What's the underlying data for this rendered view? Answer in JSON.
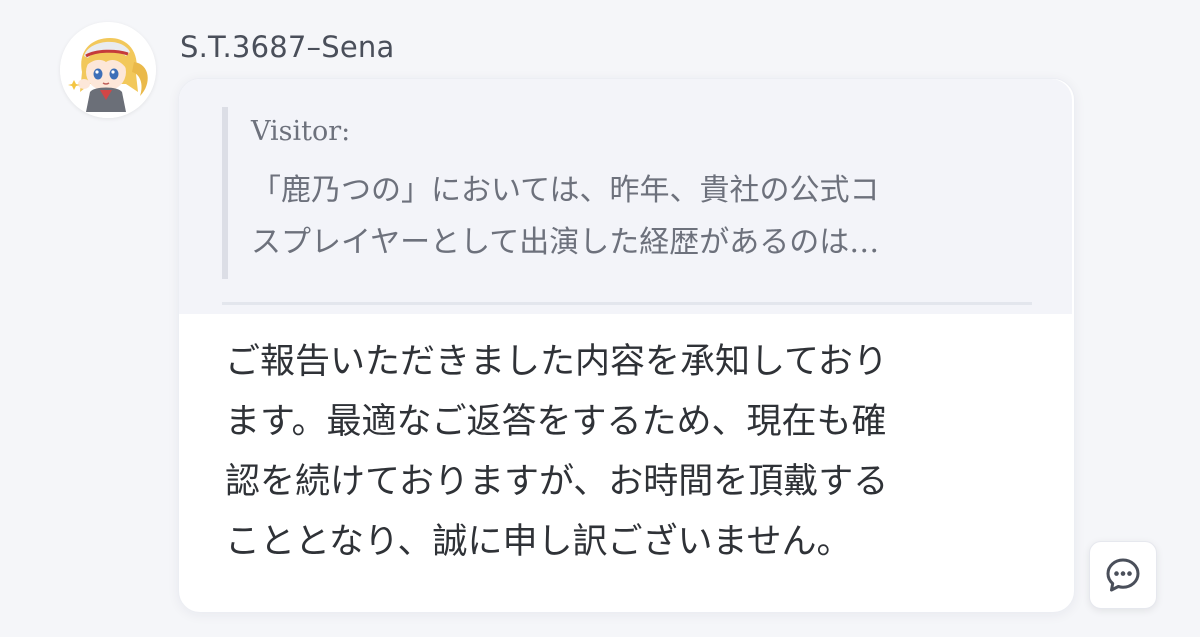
{
  "message": {
    "sender_name": "S.T.3687–Sena",
    "quote": {
      "author_label": "Visitor:",
      "text": "「鹿乃つの」においては、昨年、貴社の公式コ\nスプレイヤーとして出演した経歴があるのは…"
    },
    "reply_text": "ご報告いただきました内容を承知しており\nます。最適なご返答をするため、現在も確\n認を続けておりますが、お時間を頂戴する\nこととなり、誠に申し訳ございません。"
  },
  "icons": {
    "avatar": "anime-character-avatar",
    "chat_button": "speech-bubble-ellipsis-icon"
  },
  "colors": {
    "background": "#f5f6f9",
    "bubble": "#ffffff",
    "quote_panel": "#f3f4f9",
    "quote_text": "#6d717c",
    "reply_text": "#2f3237",
    "sender_name": "#4a4f5a"
  }
}
